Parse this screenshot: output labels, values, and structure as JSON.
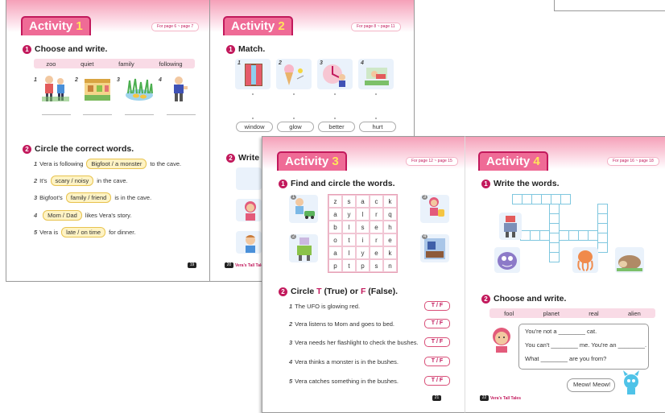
{
  "a1": {
    "title_word": "Activity",
    "title_num": "1",
    "pages": "For page 6 ~ page 7",
    "q1": "Choose and write.",
    "q1_words": [
      "zoo",
      "quiet",
      "family",
      "following"
    ],
    "q2": "Circle the correct words.",
    "nums": [
      "1",
      "2",
      "3",
      "4",
      "5"
    ],
    "lines": [
      {
        "pre": "Vera is following",
        "choice": "Bigfoot  /  a monster",
        "post": "to the cave."
      },
      {
        "pre": "It's",
        "choice": "scary  /  noisy",
        "post": "in the cave."
      },
      {
        "pre": "Bigfoot's",
        "choice": "family  /  friend",
        "post": "is in the cave."
      },
      {
        "pre": "",
        "choice": "Mom  /  Dad",
        "post": "likes Vera's story."
      },
      {
        "pre": "Vera is",
        "choice": "late  /  on time",
        "post": "for dinner."
      }
    ],
    "page": "19"
  },
  "a2": {
    "title_word": "Activity",
    "title_num": "2",
    "pages": "For page 8 ~ page 11",
    "q1": "Match.",
    "words": [
      "window",
      "glow",
      "better",
      "hurt"
    ],
    "q2": "Write th",
    "footer": "Vera's Tall Tales"
  },
  "a3": {
    "title_word": "Activity",
    "title_num": "3",
    "pages": "For page 12 ~ page 15",
    "q1": "Find and circle the words.",
    "grid": [
      "z",
      "s",
      "a",
      "c",
      "k",
      "a",
      "y",
      "l",
      "r",
      "q",
      "b",
      "l",
      "s",
      "e",
      "h",
      "o",
      "t",
      "i",
      "r",
      "e",
      "a",
      "l",
      "y",
      "e",
      "k",
      "p",
      "t",
      "p",
      "s",
      "n"
    ],
    "q2_pre": "Circle ",
    "q2_t": "T",
    "q2_mid": " (True) or ",
    "q2_f": "F",
    "q2_post": " (False).",
    "statements": [
      "The UFO is glowing red.",
      "Vera listens to Mom and goes to bed.",
      "Vera needs her flashlight to check the bushes.",
      "Vera thinks a monster is in the bushes.",
      "Vera catches something in the bushes."
    ],
    "tf": "T  /  F",
    "page": "21"
  },
  "a4": {
    "title_word": "Activity",
    "title_num": "4",
    "pages": "For page 16 ~ page 18",
    "q1": "Write the words.",
    "q2": "Choose and write.",
    "words": [
      "fool",
      "planet",
      "real",
      "alien"
    ],
    "s1": "You're not a ________ cat.",
    "s2": "You can't ________ me. You're an ________.",
    "s3": "What ________ are you from?",
    "meow": "Meow! Meow!",
    "footer": "Vera's Tall Tales"
  },
  "colors": {
    "accent": "#c2195c",
    "title_bg": "#ef6b96",
    "banner": "#f5a0b8"
  }
}
